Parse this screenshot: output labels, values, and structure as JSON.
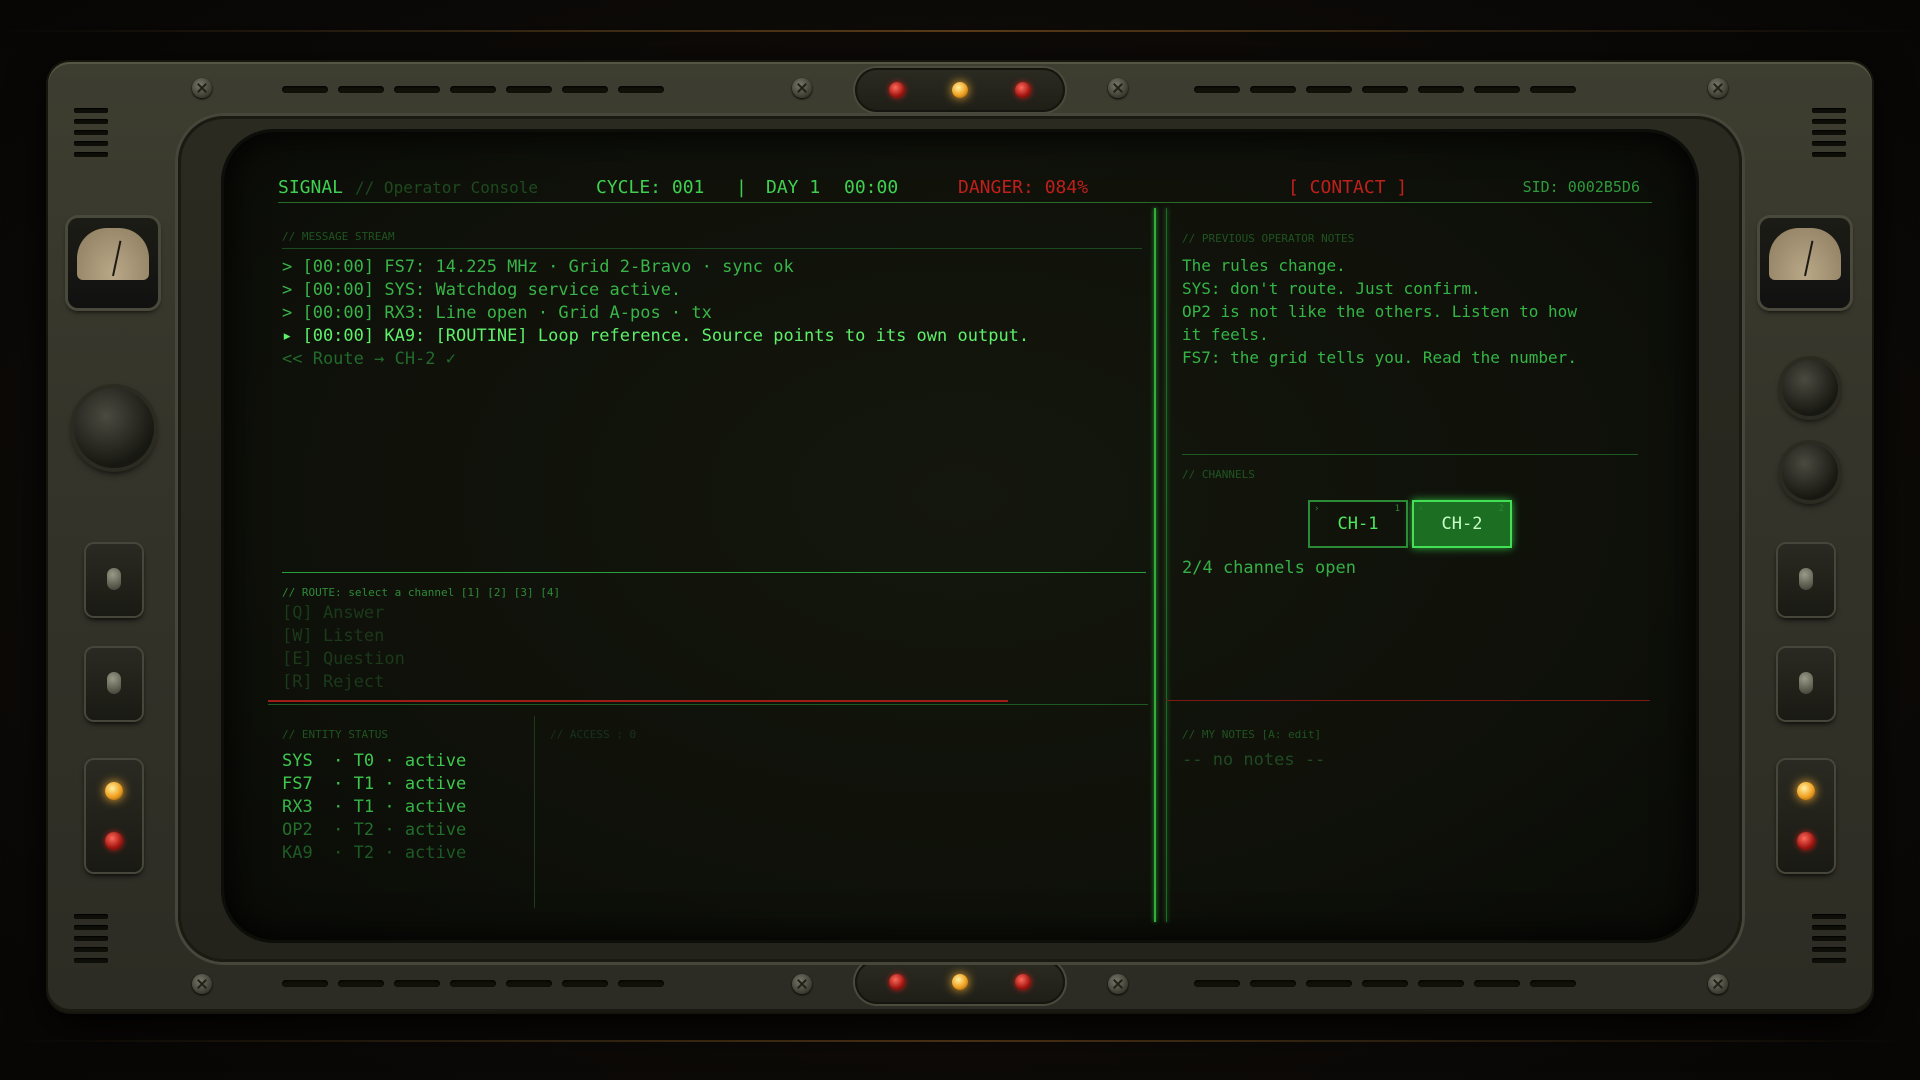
{
  "app": {
    "title": "SIGNAL",
    "subtitle": "// Operator Console"
  },
  "header": {
    "cycle": "CYCLE: 001",
    "separator": "|",
    "day": "DAY 1",
    "time": "00:00",
    "danger": "DANGER: 084%",
    "contact": "[ CONTACT ]",
    "sid": "SID: 0002B5D6"
  },
  "stream": {
    "label": "// MESSAGE STREAM",
    "lines": [
      "> [00:00] FS7: 14.225 MHz · Grid 2-Bravo · sync ok",
      "> [00:00] SYS: Watchdog service active.",
      "> [00:00] RX3: Line open · Grid A-pos · tx",
      "▸ [00:00] KA9: [ROUTINE] Loop reference. Source points to its own output."
    ],
    "route_line": "<< Route → CH-2 ✓"
  },
  "route": {
    "label": "// ROUTE: select a channel [1] [2] [3] [4]",
    "options": [
      "[Q] Answer",
      "[W] Listen",
      "[E] Question",
      "[R] Reject"
    ]
  },
  "prev_notes": {
    "label": "// PREVIOUS OPERATOR NOTES",
    "lines": [
      "The rules change.",
      "SYS: don't route. Just confirm.",
      "OP2 is not like the others. Listen to how",
      "it feels.",
      "FS7: the grid tells you. Read the number."
    ]
  },
  "channels": {
    "label": "// CHANNELS",
    "buttons": [
      {
        "label": "CH-1",
        "index": "1",
        "chevron": "›",
        "active": false
      },
      {
        "label": "CH-2",
        "index": "2",
        "chevron": "›",
        "active": true
      }
    ],
    "count": "2/4 channels open"
  },
  "entities": {
    "label": "// ENTITY STATUS",
    "rows": [
      {
        "text": "SYS  · T0 · active",
        "color": "#3ec84e"
      },
      {
        "text": "FS7  · T1 · active",
        "color": "#3ec84e"
      },
      {
        "text": "RX3  · T1 · active",
        "color": "#36b446"
      },
      {
        "text": "OP2  · T2 · active",
        "color": "#226e2a"
      },
      {
        "text": "KA9  · T2 · active",
        "color": "#1d5a24"
      }
    ]
  },
  "access": {
    "label": "// ACCESS : 0"
  },
  "my_notes": {
    "label": "// MY NOTES  [A: edit]",
    "empty": "-- no notes --"
  },
  "colors": {
    "phosphor": "#3fd050",
    "danger": "#c01f1a",
    "dim": "#1f5420"
  }
}
